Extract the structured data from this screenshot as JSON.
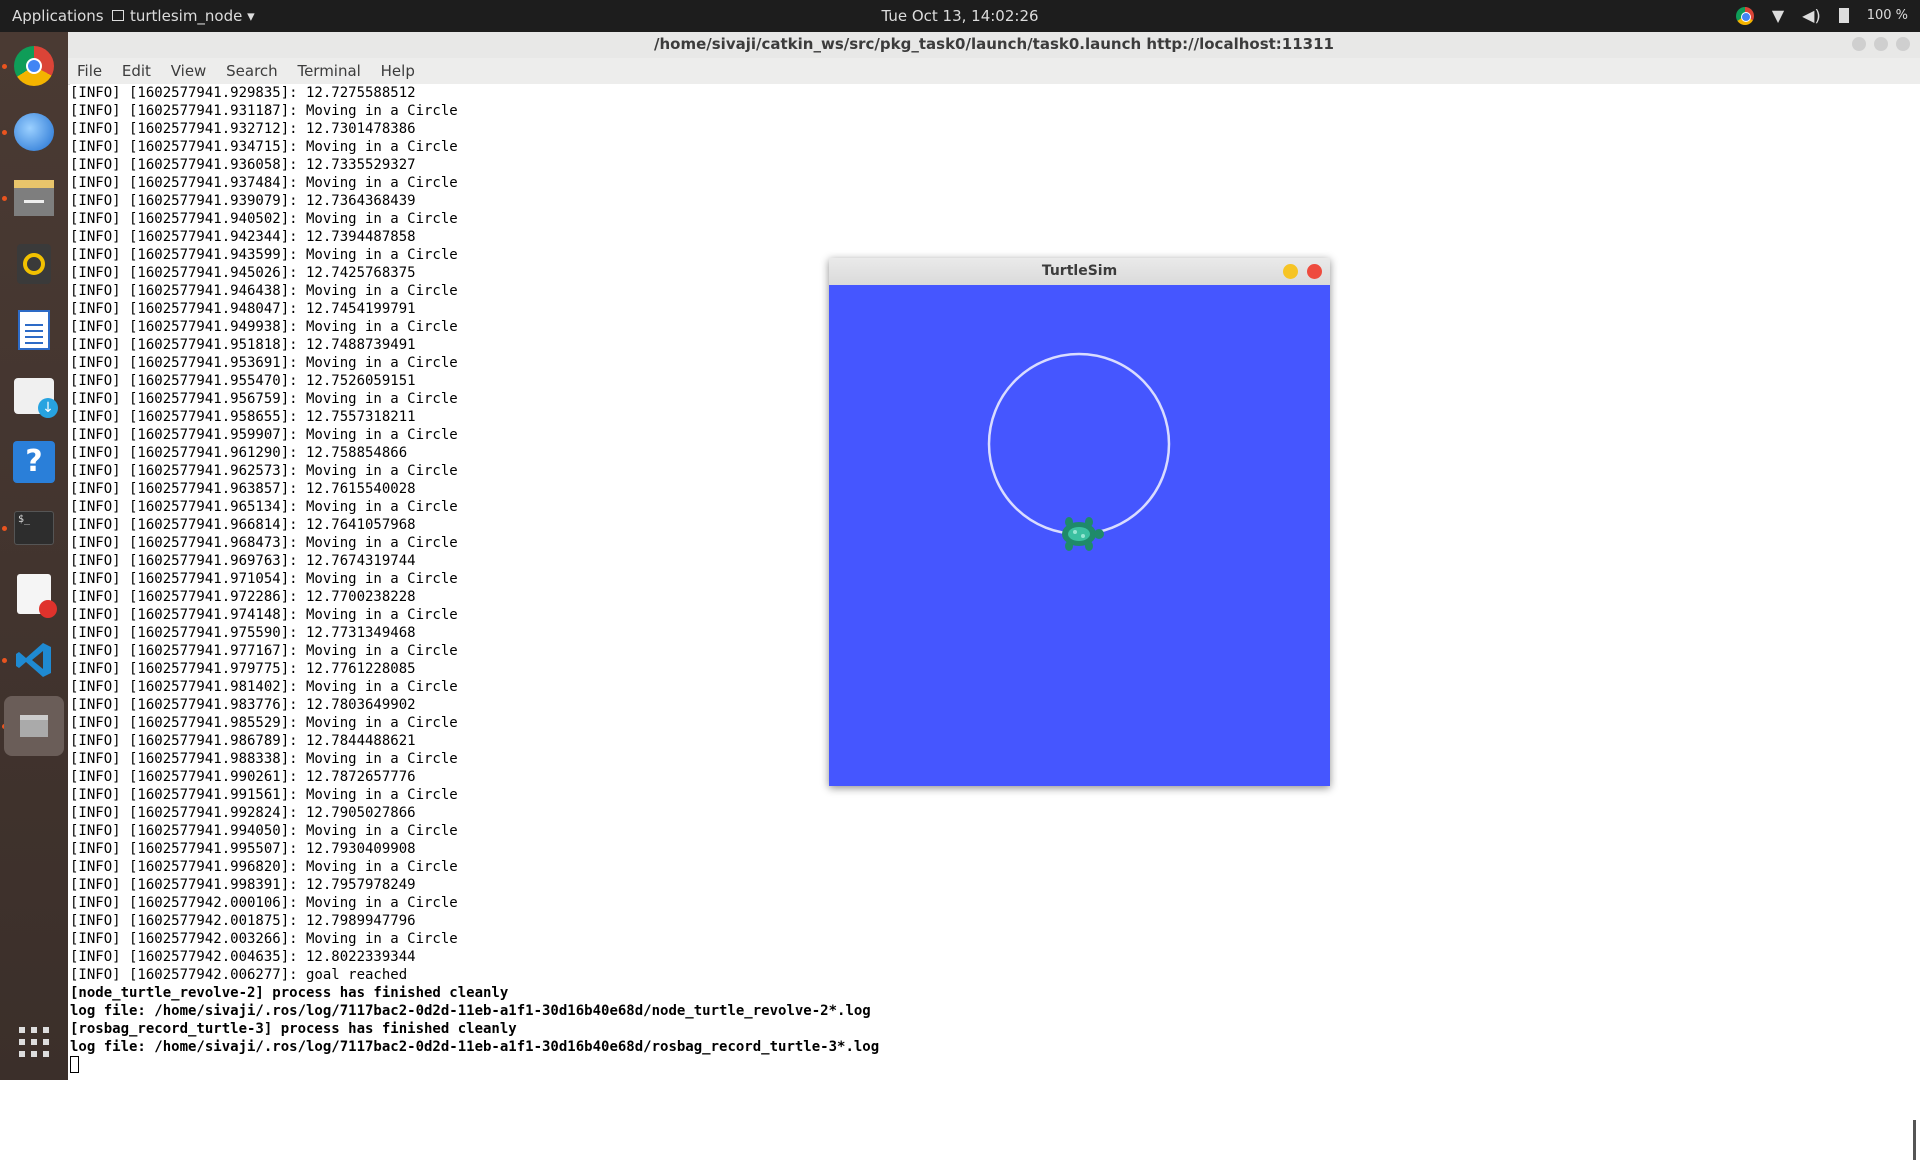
{
  "topbar": {
    "applications": "Applications",
    "app_menu": "turtlesim_node ▾",
    "datetime": "Tue Oct 13, 14:02:26",
    "battery": "100 %"
  },
  "dock": {
    "items": [
      "chrome-icon",
      "thunderbird-icon",
      "files-icon",
      "rhythmbox-icon",
      "writer-icon",
      "software-icon",
      "help-icon",
      "terminal-icon",
      "text-editor-icon",
      "vscode-icon",
      "window-icon",
      "show-apps-icon"
    ]
  },
  "terminal": {
    "title": "/home/sivaji/catkin_ws/src/pkg_task0/launch/task0.launch http://localhost:11311",
    "menu": [
      "File",
      "Edit",
      "View",
      "Search",
      "Terminal",
      "Help"
    ],
    "lines": [
      "[INFO] [1602577941.929835]: 12.7275588512",
      "[INFO] [1602577941.931187]: Moving in a Circle",
      "[INFO] [1602577941.932712]: 12.7301478386",
      "[INFO] [1602577941.934715]: Moving in a Circle",
      "[INFO] [1602577941.936058]: 12.7335529327",
      "[INFO] [1602577941.937484]: Moving in a Circle",
      "[INFO] [1602577941.939079]: 12.7364368439",
      "[INFO] [1602577941.940502]: Moving in a Circle",
      "[INFO] [1602577941.942344]: 12.7394487858",
      "[INFO] [1602577941.943599]: Moving in a Circle",
      "[INFO] [1602577941.945026]: 12.7425768375",
      "[INFO] [1602577941.946438]: Moving in a Circle",
      "[INFO] [1602577941.948047]: 12.7454199791",
      "[INFO] [1602577941.949938]: Moving in a Circle",
      "[INFO] [1602577941.951818]: 12.7488739491",
      "[INFO] [1602577941.953691]: Moving in a Circle",
      "[INFO] [1602577941.955470]: 12.7526059151",
      "[INFO] [1602577941.956759]: Moving in a Circle",
      "[INFO] [1602577941.958655]: 12.7557318211",
      "[INFO] [1602577941.959907]: Moving in a Circle",
      "[INFO] [1602577941.961290]: 12.758854866",
      "[INFO] [1602577941.962573]: Moving in a Circle",
      "[INFO] [1602577941.963857]: 12.7615540028",
      "[INFO] [1602577941.965134]: Moving in a Circle",
      "[INFO] [1602577941.966814]: 12.7641057968",
      "[INFO] [1602577941.968473]: Moving in a Circle",
      "[INFO] [1602577941.969763]: 12.7674319744",
      "[INFO] [1602577941.971054]: Moving in a Circle",
      "[INFO] [1602577941.972286]: 12.7700238228",
      "[INFO] [1602577941.974148]: Moving in a Circle",
      "[INFO] [1602577941.975590]: 12.7731349468",
      "[INFO] [1602577941.977167]: Moving in a Circle",
      "[INFO] [1602577941.979775]: 12.7761228085",
      "[INFO] [1602577941.981402]: Moving in a Circle",
      "[INFO] [1602577941.983776]: 12.7803649902",
      "[INFO] [1602577941.985529]: Moving in a Circle",
      "[INFO] [1602577941.986789]: 12.7844488621",
      "[INFO] [1602577941.988338]: Moving in a Circle",
      "[INFO] [1602577941.990261]: 12.7872657776",
      "[INFO] [1602577941.991561]: Moving in a Circle",
      "[INFO] [1602577941.992824]: 12.7905027866",
      "[INFO] [1602577941.994050]: Moving in a Circle",
      "[INFO] [1602577941.995507]: 12.7930409908",
      "[INFO] [1602577941.996820]: Moving in a Circle",
      "[INFO] [1602577941.998391]: 12.7957978249",
      "[INFO] [1602577942.000106]: Moving in a Circle",
      "[INFO] [1602577942.001875]: 12.7989947796",
      "[INFO] [1602577942.003266]: Moving in a Circle",
      "[INFO] [1602577942.004635]: 12.8022339344",
      "[INFO] [1602577942.006277]: goal reached"
    ],
    "bold_lines": [
      "[node_turtle_revolve-2] process has finished cleanly",
      "log file: /home/sivaji/.ros/log/7117bac2-0d2d-11eb-a1f1-30d16b40e68d/node_turtle_revolve-2*.log",
      "[rosbag_record_turtle-3] process has finished cleanly",
      "log file: /home/sivaji/.ros/log/7117bac2-0d2d-11eb-a1f1-30d16b40e68d/rosbag_record_turtle-3*.log"
    ]
  },
  "turtlesim": {
    "title": "TurtleSim",
    "background_color": "#4556ff",
    "trail_color": "#d9dcff"
  }
}
